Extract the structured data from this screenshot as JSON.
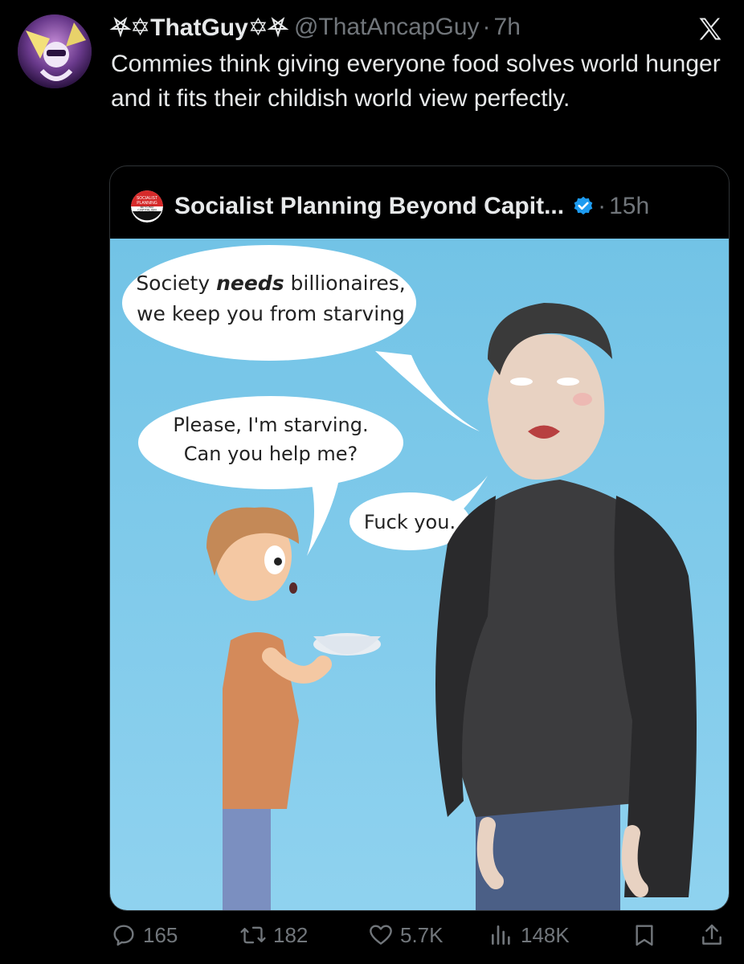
{
  "tweet": {
    "display_name": "⛧✡ThatGuy✡⛧",
    "handle": "@ThatAncapGuy",
    "separator": "·",
    "time": "7h",
    "text": "Commies think giving everyone food solves world hunger and it fits their childish world view perfectly."
  },
  "quoted_tweet": {
    "avatar_text": [
      "SOCIALIST",
      "PLANNING",
      "BEYOND",
      "CAPITALISM"
    ],
    "display_name": "Socialist Planning Beyond Capit...",
    "separator": "·",
    "time": "15h",
    "comic": {
      "bubble_billionaire": {
        "pre": "Society ",
        "emph": "needs",
        "post": " billionaires,",
        "line2": "we keep you from starving"
      },
      "bubble_child": {
        "line1": "Please, I'm starving.",
        "line2": "Can you help me?"
      },
      "bubble_reply": "Fuck you."
    }
  },
  "actions": {
    "replies": "165",
    "retweets": "182",
    "likes": "5.7K",
    "views": "148K"
  },
  "icons": {
    "logo": "x-logo-icon",
    "verified": "verified-badge-icon",
    "reply": "reply-icon",
    "retweet": "retweet-icon",
    "like": "heart-icon",
    "views": "views-icon",
    "bookmark": "bookmark-icon",
    "share": "share-icon"
  },
  "colors": {
    "background": "#000000",
    "text": "#e7e9ea",
    "muted": "#71767b",
    "verified": "#1d9bf0",
    "comic_sky": "#6fc6ea"
  }
}
